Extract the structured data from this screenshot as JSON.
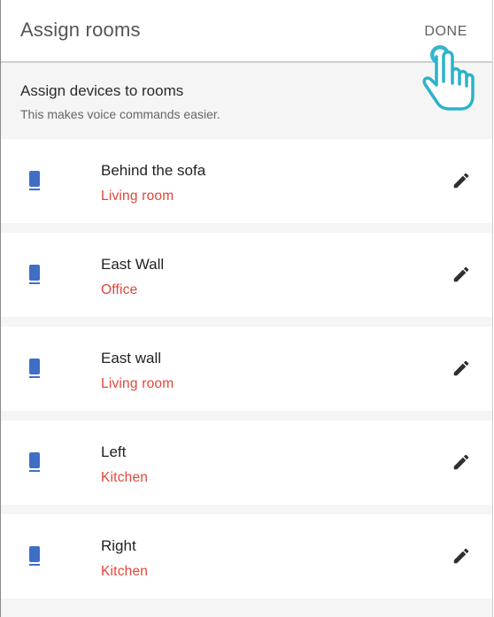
{
  "header": {
    "title": "Assign rooms",
    "done_label": "DONE"
  },
  "intro": {
    "title": "Assign devices to rooms",
    "subtitle": "This makes voice commands easier."
  },
  "devices": [
    {
      "name": "Behind the sofa",
      "room": "Living room"
    },
    {
      "name": "East Wall",
      "room": "Office"
    },
    {
      "name": "East wall",
      "room": "Living room"
    },
    {
      "name": "Left",
      "room": "Kitchen"
    },
    {
      "name": "Right",
      "room": "Kitchen"
    }
  ],
  "icons": {
    "device": "speaker-icon",
    "edit": "pencil-icon",
    "cursor": "hand-pointer-icon"
  },
  "colors": {
    "room_text": "#e0463a",
    "speaker": "#3f6fc4",
    "cursor": "#2bb3c9"
  }
}
